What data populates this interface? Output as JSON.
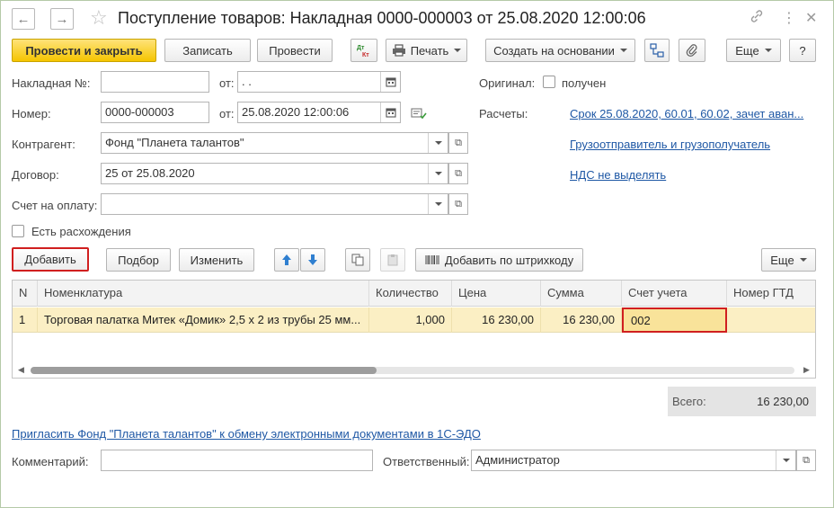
{
  "window": {
    "title": "Поступление товаров: Накладная 0000-000003 от 25.08.2020 12:00:06"
  },
  "icons": {
    "back": "arrow-left-icon",
    "forward": "arrow-right-icon",
    "favorite": "star-icon",
    "link": "link-icon",
    "more": "more-vertical-icon",
    "close": "close-icon"
  },
  "toolbar": {
    "post_and_close": "Провести и закрыть",
    "save": "Записать",
    "post": "Провести",
    "dt_kt": "Дт Кт",
    "print": "Печать",
    "create_based_on": "Создать на основании",
    "more": "Еще",
    "help": "?"
  },
  "form": {
    "invoice_no_label": "Накладная №:",
    "invoice_no_value": "",
    "invoice_date_label": "от:",
    "invoice_date_value": " .  .",
    "number_label": "Номер:",
    "number_value": "0000-000003",
    "date_label": "от:",
    "date_value": "25.08.2020 12:00:06",
    "counterparty_label": "Контрагент:",
    "counterparty_value": "Фонд \"Планета талантов\"",
    "contract_label": "Договор:",
    "contract_value": "25 от 25.08.2020",
    "payment_invoice_label": "Счет на оплату:",
    "payment_invoice_value": "",
    "discrepancies_label": "Есть расхождения",
    "original_label": "Оригинал:",
    "received_label": "получен",
    "settlements_label": "Расчеты:",
    "settlements_link": "Срок 25.08.2020, 60.01, 60.02, зачет аван...",
    "shipper_link": "Грузоотправитель и грузополучатель",
    "vat_link": "НДС не выделять"
  },
  "table_toolbar": {
    "add": "Добавить",
    "pick": "Подбор",
    "change": "Изменить",
    "add_barcode": "Добавить по штрихкоду",
    "more": "Еще"
  },
  "table": {
    "headers": [
      "N",
      "Номенклатура",
      "Количество",
      "Цена",
      "Сумма",
      "Счет учета",
      "Номер ГТД"
    ],
    "rows": [
      {
        "n": "1",
        "item": "Торговая палатка Митек «Домик» 2,5 х 2 из трубы 25 мм...",
        "qty": "1,000",
        "price": "16 230,00",
        "sum": "16 230,00",
        "account": "002",
        "gtd": ""
      }
    ]
  },
  "totals": {
    "label": "Всего:",
    "value": "16 230,00"
  },
  "footer": {
    "invite_link": "Пригласить Фонд \"Планета талантов\" к обмену электронными документами в 1С-ЭДО",
    "comment_label": "Комментарий:",
    "comment_value": "",
    "responsible_label": "Ответственный:",
    "responsible_value": "Администратор"
  },
  "colors": {
    "primary_button": "#f5c500",
    "link": "#1f58a5",
    "selected_row": "#fbefc4",
    "highlight_border": "#d01f1f"
  }
}
